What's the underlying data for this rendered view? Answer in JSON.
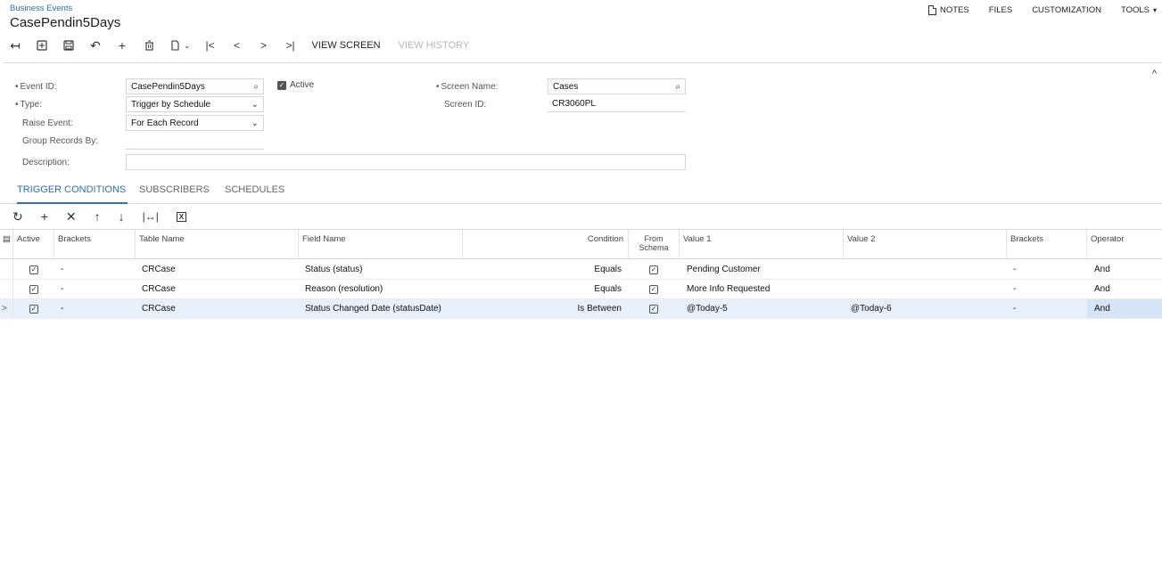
{
  "breadcrumb": "Business Events",
  "page_title": "CasePendin5Days",
  "top_links": {
    "notes": "NOTES",
    "files": "FILES",
    "customization": "CUSTOMIZATION",
    "tools": "TOOLS"
  },
  "toolbar": {
    "view_screen": "VIEW SCREEN",
    "view_history": "VIEW HISTORY"
  },
  "form": {
    "event_id_label": "Event ID:",
    "event_id_value": "CasePendin5Days",
    "active_label": "Active",
    "type_label": "Type:",
    "type_value": "Trigger by Schedule",
    "raise_event_label": "Raise Event:",
    "raise_event_value": "For Each Record",
    "group_records_label": "Group Records By:",
    "description_label": "Description:",
    "description_value": "",
    "screen_name_label": "Screen Name:",
    "screen_name_value": "Cases",
    "screen_id_label": "Screen ID:",
    "screen_id_value": "CR3060PL"
  },
  "tabs": [
    "TRIGGER CONDITIONS",
    "SUBSCRIBERS",
    "SCHEDULES"
  ],
  "grid": {
    "headers": {
      "active": "Active",
      "brackets_open": "Brackets",
      "table_name": "Table Name",
      "field_name": "Field Name",
      "condition": "Condition",
      "from_schema_1": "From",
      "from_schema_2": "Schema",
      "value1": "Value 1",
      "value2": "Value 2",
      "brackets_close": "Brackets",
      "operator": "Operator"
    },
    "rows": [
      {
        "brackets_open": "-",
        "table_name": "CRCase",
        "field_name": "Status (status)",
        "condition": "Equals",
        "value1": "Pending Customer",
        "value2": "",
        "brackets_close": "-",
        "operator": "And"
      },
      {
        "brackets_open": "-",
        "table_name": "CRCase",
        "field_name": "Reason (resolution)",
        "condition": "Equals",
        "value1": "More Info Requested",
        "value2": "",
        "brackets_close": "-",
        "operator": "And"
      },
      {
        "brackets_open": "-",
        "table_name": "CRCase",
        "field_name": "Status Changed Date (statusDate)",
        "condition": "Is Between",
        "value1": "@Today-5",
        "value2": "@Today-6",
        "brackets_close": "-",
        "operator": "And"
      }
    ]
  },
  "colors": {
    "accent": "#2f6fb5",
    "selected_row": "#e8f0fb"
  }
}
